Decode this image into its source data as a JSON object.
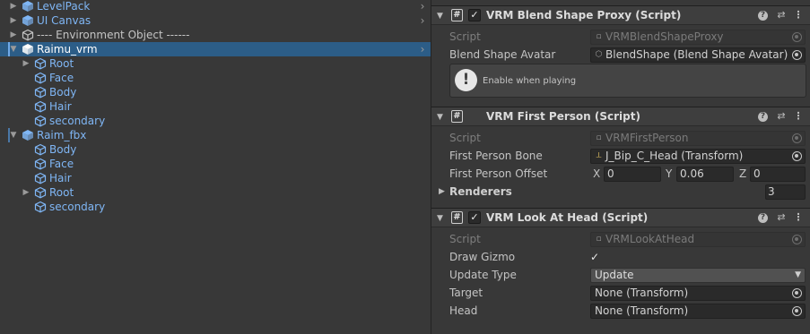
{
  "hierarchy": {
    "rows": [
      {
        "label": "LevelPack",
        "kind": "prefab",
        "indent": 0,
        "arrow": "right",
        "more": true
      },
      {
        "label": "UI Canvas",
        "kind": "prefab",
        "indent": 0,
        "arrow": "right",
        "more": true
      },
      {
        "label": "---- Environment Object ------",
        "kind": "plain",
        "indent": 0,
        "arrow": "right",
        "more": false
      },
      {
        "label": "Raimu_vrm",
        "kind": "prefab",
        "indent": 0,
        "arrow": "down",
        "more": true,
        "selected": true
      },
      {
        "label": "Root",
        "kind": "prefab",
        "indent": 1,
        "arrow": "right",
        "more": false
      },
      {
        "label": "Face",
        "kind": "prefab",
        "indent": 1,
        "arrow": "none",
        "more": false
      },
      {
        "label": "Body",
        "kind": "prefab",
        "indent": 1,
        "arrow": "none",
        "more": false
      },
      {
        "label": "Hair",
        "kind": "prefab",
        "indent": 1,
        "arrow": "none",
        "more": false
      },
      {
        "label": "secondary",
        "kind": "prefab",
        "indent": 1,
        "arrow": "none",
        "more": false
      },
      {
        "label": "Raim_fbx",
        "kind": "prefab",
        "indent": 0,
        "arrow": "down",
        "more": false
      },
      {
        "label": "Body",
        "kind": "prefab",
        "indent": 1,
        "arrow": "none",
        "more": false
      },
      {
        "label": "Face",
        "kind": "prefab",
        "indent": 1,
        "arrow": "none",
        "more": false
      },
      {
        "label": "Hair",
        "kind": "prefab",
        "indent": 1,
        "arrow": "none",
        "more": false
      },
      {
        "label": "Root",
        "kind": "prefab",
        "indent": 1,
        "arrow": "right",
        "more": false
      },
      {
        "label": "secondary",
        "kind": "prefab",
        "indent": 1,
        "arrow": "none",
        "more": false
      }
    ]
  },
  "inspector": {
    "blend_shape_proxy": {
      "title": "VRM Blend Shape Proxy (Script)",
      "script_label": "Script",
      "script_value": "VRMBlendShapeProxy",
      "avatar_label": "Blend Shape Avatar",
      "avatar_value": "BlendShape (Blend Shape Avatar)",
      "help_text": "Enable when playing"
    },
    "first_person": {
      "title": "VRM First Person (Script)",
      "script_label": "Script",
      "script_value": "VRMFirstPerson",
      "bone_label": "First Person Bone",
      "bone_value": "J_Bip_C_Head (Transform)",
      "offset_label": "First Person Offset",
      "offset_x_label": "X",
      "offset_x": "0",
      "offset_y_label": "Y",
      "offset_y": "0.06",
      "offset_z_label": "Z",
      "offset_z": "0",
      "renderers_label": "Renderers",
      "renderers_count": "3"
    },
    "look_at_head": {
      "title": "VRM Look At Head (Script)",
      "script_label": "Script",
      "script_value": "VRMLookAtHead",
      "gizmo_label": "Draw Gizmo",
      "gizmo_check": "✓",
      "update_type_label": "Update Type",
      "update_type_value": "Update",
      "target_label": "Target",
      "target_value": "None (Transform)",
      "head_label": "Head",
      "head_value": "None (Transform)"
    },
    "header_icons": {
      "help": "?",
      "preset": "⇄",
      "menu": "⋮",
      "script": "#",
      "check": "✓"
    }
  },
  "colors": {
    "background": "#383838",
    "selection": "#2c5d87",
    "prefab_text": "#7fb6f5",
    "header": "#3e3e3e"
  }
}
